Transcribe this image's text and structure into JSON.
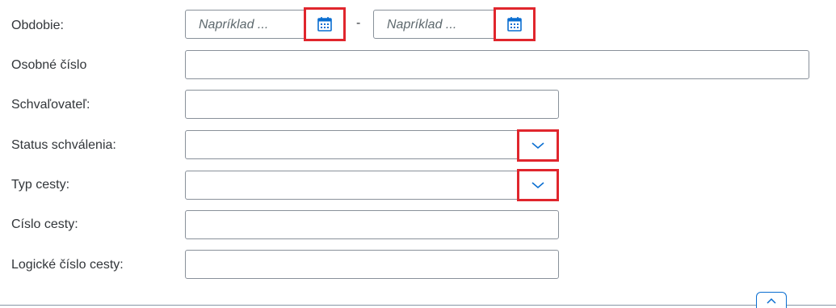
{
  "form": {
    "period": {
      "label": "Obdobie:",
      "from_placeholder": "Napríklad ...",
      "separator": "-",
      "to_placeholder": "Napríklad ..."
    },
    "personal_number": {
      "label": "Osobné číslo",
      "value": ""
    },
    "approver": {
      "label": "Schvaľovateľ:",
      "value": ""
    },
    "approval_status": {
      "label": "Status schválenia:",
      "value": ""
    },
    "trip_type": {
      "label": "Typ cesty:",
      "value": ""
    },
    "trip_number": {
      "label": "Císlo cesty:",
      "value": ""
    },
    "logical_trip_number": {
      "label": "Logické číslo cesty:",
      "value": ""
    }
  },
  "icons": {
    "calendar": "calendar-icon",
    "dropdown": "chevron-down-icon",
    "collapse": "chevron-up-icon"
  },
  "colors": {
    "highlight": "#e0262d",
    "icon_blue": "#0a6ed1",
    "border": "#89919a",
    "label_text": "#32363a",
    "placeholder_text": "#5e696e"
  }
}
